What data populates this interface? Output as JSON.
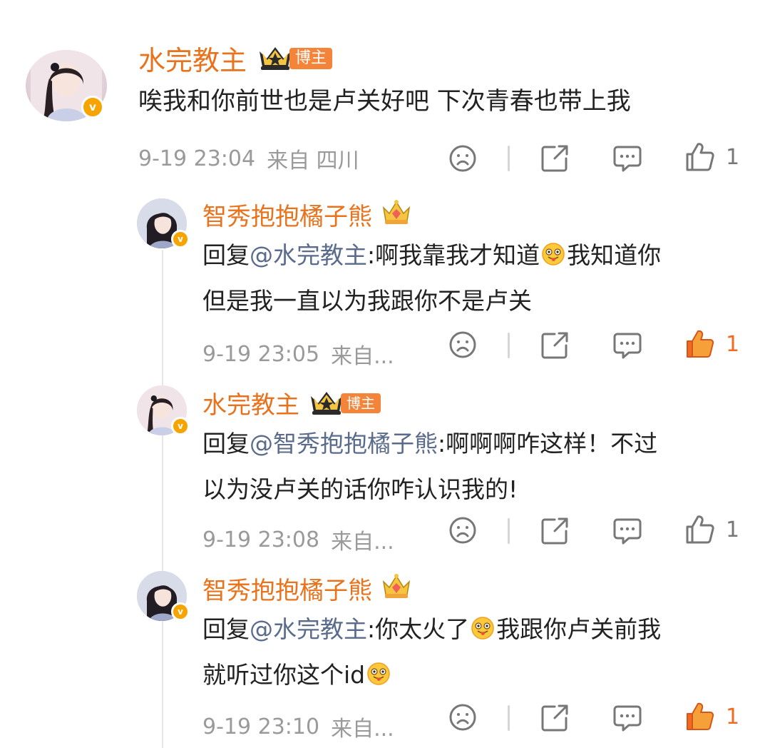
{
  "comments": [
    {
      "username": "水完教主",
      "tag": "博主",
      "text": "唉我和你前世也是卢关好吧 下次青春也带上我",
      "timestamp": "9-19 23:04",
      "location": "来自 四川",
      "likes": "1",
      "liked": false,
      "badge": "v"
    },
    {
      "username": "智秀抱抱橘子熊",
      "reply_prefix": "回复",
      "mention": "@水完教主",
      "text_line1": ":啊我靠我才知道",
      "text_line1b": "我知道你",
      "text_line2": "但是我一直以为我跟你不是卢关",
      "timestamp": "9-19 23:05",
      "location": "来自...",
      "likes": "1",
      "liked": true,
      "badge": "v"
    },
    {
      "username": "水完教主",
      "tag": "博主",
      "reply_prefix": "回复",
      "mention": "@智秀抱抱橘子熊",
      "text_line1": ":啊啊啊咋这样！不过",
      "text_line2": "以为没卢关的话你咋认识我的!",
      "timestamp": "9-19 23:08",
      "location": "来自...",
      "likes": "1",
      "liked": false,
      "badge": "v"
    },
    {
      "username": "智秀抱抱橘子熊",
      "reply_prefix": "回复",
      "mention": "@水完教主",
      "text_line1": ":你太火了",
      "text_line1b": "我跟你卢关前我",
      "text_line2": "就听过你这个id",
      "timestamp": "9-19 23:10",
      "location": "来自...",
      "likes": "1",
      "liked": true,
      "badge": "v"
    }
  ],
  "colors": {
    "username": "#e8731c",
    "mention": "#5a6b8c",
    "meta": "#9a9a9a",
    "like_active": "#f26a22",
    "badge": "#f7a400"
  },
  "icons": {
    "react": "sad-face-icon",
    "share": "share-icon",
    "comment": "comment-icon",
    "like": "thumbs-up-icon",
    "crown": "crown-icon",
    "emoji": "tongue-out-emoji-icon"
  }
}
